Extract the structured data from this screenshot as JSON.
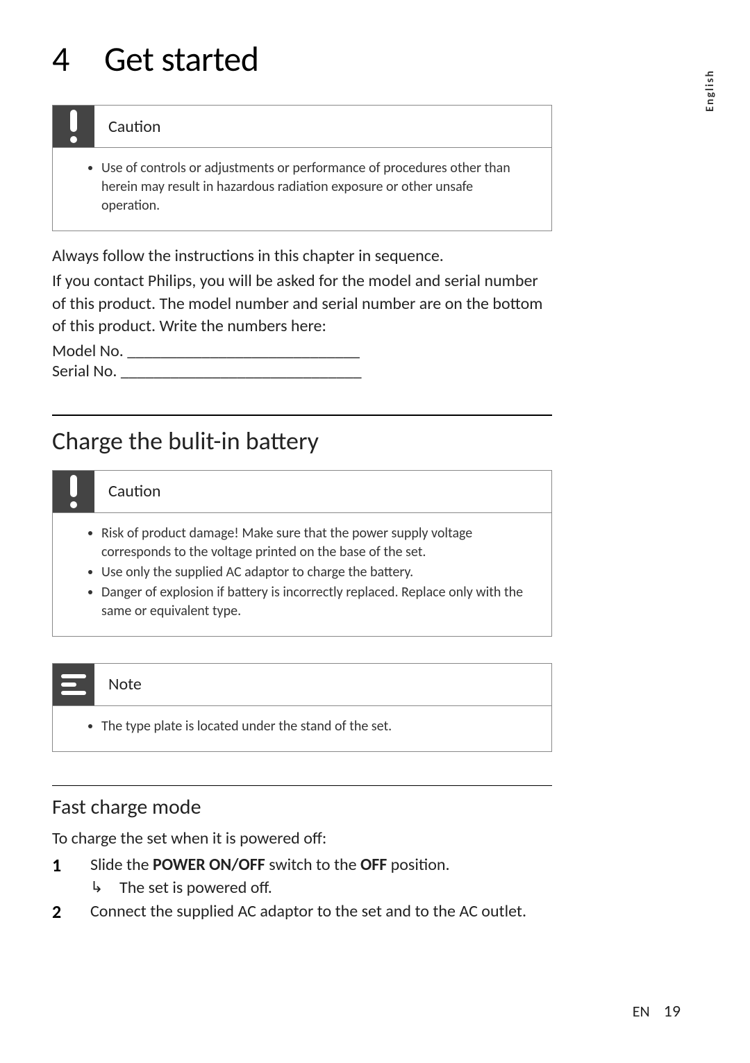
{
  "chapter": {
    "number": "4",
    "title": "Get started"
  },
  "language_tab": "English",
  "caution1": {
    "title": "Caution",
    "items": [
      "Use of controls or adjustments or performance of procedures other than herein may result in hazardous radiation exposure or other unsafe operation."
    ]
  },
  "intro": {
    "line1": "Always follow the instructions in this chapter in sequence.",
    "line2": "If you contact Philips, you will be asked for the model and serial number of this product. The model number and serial number are on the bottom of this product. Write the numbers here:",
    "model_label": "Model No. ____________________________",
    "serial_label": "Serial No. _____________________________"
  },
  "section1": {
    "heading": "Charge the bulit-in battery"
  },
  "caution2": {
    "title": "Caution",
    "items": [
      "Risk of product damage! Make sure that the power supply voltage corresponds to the voltage printed on the base of the set.",
      "Use only the supplied AC adaptor to charge the battery.",
      "Danger of explosion if battery is incorrectly replaced. Replace only with the same or equivalent type."
    ]
  },
  "note1": {
    "title": "Note",
    "items": [
      "The type plate is located under the stand of the set."
    ]
  },
  "subsection1": {
    "heading": "Fast charge mode",
    "instruction": "To charge the set when it is powered off:",
    "step1_pre": "Slide the ",
    "step1_b1": "POWER ON/OFF",
    "step1_mid": " switch to the ",
    "step1_b2": "OFF",
    "step1_post": " position.",
    "step1_sub": "The set is powered off.",
    "step2": "Connect the supplied AC adaptor to the set and to the AC outlet."
  },
  "footer": {
    "lang": "EN",
    "page": "19"
  }
}
